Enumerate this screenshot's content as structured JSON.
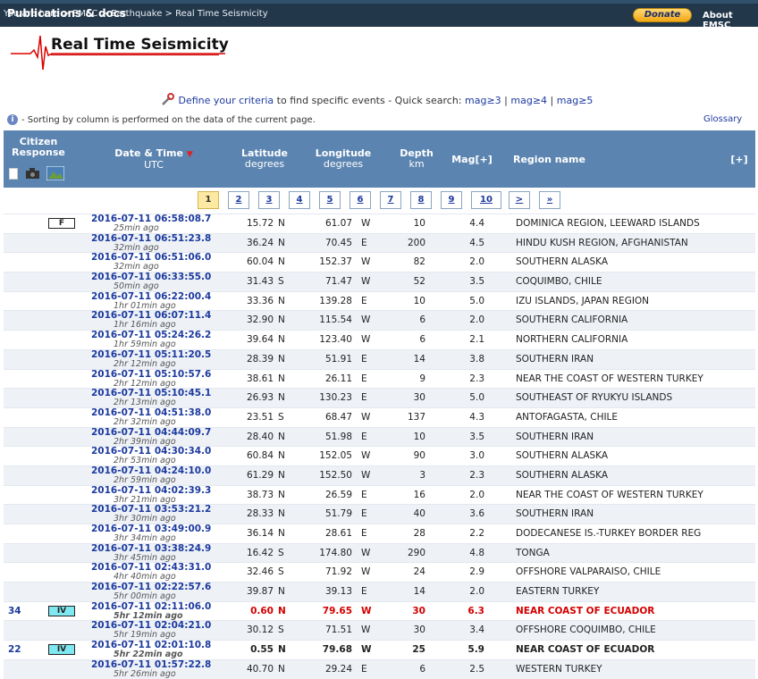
{
  "nav": {
    "breadcrumb": [
      "You are here",
      "EMSC",
      "Earthquake",
      "Real Time Seismicity"
    ],
    "breadcrumb_sep": ">",
    "publications_label": "Publications & docs",
    "donate_label": "Donate",
    "about_label": "About EMSC"
  },
  "page_title": "Real Time Seismicity",
  "criteria": {
    "link_text": "Define your criteria",
    "middle_text": "to find specific events - Quick search:",
    "quick": [
      "mag≥3",
      "mag≥4",
      "mag≥5"
    ]
  },
  "info_text": "- Sorting by column is performed on the data of the current page.",
  "glossary_label": "Glossary",
  "headers": {
    "citizen": "Citizen",
    "response": "Response",
    "datetime": "Date & Time",
    "datetime_sub": "UTC",
    "lat": "Latitude",
    "lat_sub": "degrees",
    "lon": "Longitude",
    "lon_sub": "degrees",
    "depth": "Depth",
    "depth_sub": "km",
    "mag": "Mag[+]",
    "region": "Region name",
    "expand": "[+]"
  },
  "pages": [
    "1",
    "2",
    "3",
    "4",
    "5",
    "6",
    "7",
    "8",
    "9",
    "10",
    ">",
    "»"
  ],
  "active_page": "1",
  "events": [
    {
      "count": "",
      "intensity": "F",
      "dt": "2016-07-11   06:58:08.7",
      "ago": "25min ago",
      "lat": "15.72",
      "ns": "N",
      "lon": "61.07",
      "ew": "W",
      "depth": "10",
      "mag": "4.4",
      "region": "DOMINICA REGION, LEEWARD ISLANDS"
    },
    {
      "count": "",
      "intensity": "",
      "dt": "2016-07-11   06:51:23.8",
      "ago": "32min ago",
      "lat": "36.24",
      "ns": "N",
      "lon": "70.45",
      "ew": "E",
      "depth": "200",
      "mag": "4.5",
      "region": "HINDU KUSH REGION, AFGHANISTAN"
    },
    {
      "count": "",
      "intensity": "",
      "dt": "2016-07-11   06:51:06.0",
      "ago": "32min ago",
      "lat": "60.04",
      "ns": "N",
      "lon": "152.37",
      "ew": "W",
      "depth": "82",
      "mag": "2.0",
      "region": "SOUTHERN ALASKA"
    },
    {
      "count": "",
      "intensity": "",
      "dt": "2016-07-11   06:33:55.0",
      "ago": "50min ago",
      "lat": "31.43",
      "ns": "S",
      "lon": "71.47",
      "ew": "W",
      "depth": "52",
      "mag": "3.5",
      "region": "COQUIMBO, CHILE"
    },
    {
      "count": "",
      "intensity": "",
      "dt": "2016-07-11   06:22:00.4",
      "ago": "1hr 01min ago",
      "lat": "33.36",
      "ns": "N",
      "lon": "139.28",
      "ew": "E",
      "depth": "10",
      "mag": "5.0",
      "region": "IZU ISLANDS, JAPAN REGION"
    },
    {
      "count": "",
      "intensity": "",
      "dt": "2016-07-11   06:07:11.4",
      "ago": "1hr 16min ago",
      "lat": "32.90",
      "ns": "N",
      "lon": "115.54",
      "ew": "W",
      "depth": "6",
      "mag": "2.0",
      "region": "SOUTHERN CALIFORNIA"
    },
    {
      "count": "",
      "intensity": "",
      "dt": "2016-07-11   05:24:26.2",
      "ago": "1hr 59min ago",
      "lat": "39.64",
      "ns": "N",
      "lon": "123.40",
      "ew": "W",
      "depth": "6",
      "mag": "2.1",
      "region": "NORTHERN CALIFORNIA"
    },
    {
      "count": "",
      "intensity": "",
      "dt": "2016-07-11   05:11:20.5",
      "ago": "2hr 12min ago",
      "lat": "28.39",
      "ns": "N",
      "lon": "51.91",
      "ew": "E",
      "depth": "14",
      "mag": "3.8",
      "region": "SOUTHERN IRAN"
    },
    {
      "count": "",
      "intensity": "",
      "dt": "2016-07-11   05:10:57.6",
      "ago": "2hr 12min ago",
      "lat": "38.61",
      "ns": "N",
      "lon": "26.11",
      "ew": "E",
      "depth": "9",
      "mag": "2.3",
      "region": "NEAR THE COAST OF WESTERN TURKEY"
    },
    {
      "count": "",
      "intensity": "",
      "dt": "2016-07-11   05:10:45.1",
      "ago": "2hr 13min ago",
      "lat": "26.93",
      "ns": "N",
      "lon": "130.23",
      "ew": "E",
      "depth": "30",
      "mag": "5.0",
      "region": "SOUTHEAST OF RYUKYU ISLANDS"
    },
    {
      "count": "",
      "intensity": "",
      "dt": "2016-07-11   04:51:38.0",
      "ago": "2hr 32min ago",
      "lat": "23.51",
      "ns": "S",
      "lon": "68.47",
      "ew": "W",
      "depth": "137",
      "mag": "4.3",
      "region": "ANTOFAGASTA, CHILE"
    },
    {
      "count": "",
      "intensity": "",
      "dt": "2016-07-11   04:44:09.7",
      "ago": "2hr 39min ago",
      "lat": "28.40",
      "ns": "N",
      "lon": "51.98",
      "ew": "E",
      "depth": "10",
      "mag": "3.5",
      "region": "SOUTHERN IRAN"
    },
    {
      "count": "",
      "intensity": "",
      "dt": "2016-07-11   04:30:34.0",
      "ago": "2hr 53min ago",
      "lat": "60.84",
      "ns": "N",
      "lon": "152.05",
      "ew": "W",
      "depth": "90",
      "mag": "3.0",
      "region": "SOUTHERN ALASKA"
    },
    {
      "count": "",
      "intensity": "",
      "dt": "2016-07-11   04:24:10.0",
      "ago": "2hr 59min ago",
      "lat": "61.29",
      "ns": "N",
      "lon": "152.50",
      "ew": "W",
      "depth": "3",
      "mag": "2.3",
      "region": "SOUTHERN ALASKA"
    },
    {
      "count": "",
      "intensity": "",
      "dt": "2016-07-11   04:02:39.3",
      "ago": "3hr 21min ago",
      "lat": "38.73",
      "ns": "N",
      "lon": "26.59",
      "ew": "E",
      "depth": "16",
      "mag": "2.0",
      "region": "NEAR THE COAST OF WESTERN TURKEY"
    },
    {
      "count": "",
      "intensity": "",
      "dt": "2016-07-11   03:53:21.2",
      "ago": "3hr 30min ago",
      "lat": "28.33",
      "ns": "N",
      "lon": "51.79",
      "ew": "E",
      "depth": "40",
      "mag": "3.6",
      "region": "SOUTHERN IRAN"
    },
    {
      "count": "",
      "intensity": "",
      "dt": "2016-07-11   03:49:00.9",
      "ago": "3hr 34min ago",
      "lat": "36.14",
      "ns": "N",
      "lon": "28.61",
      "ew": "E",
      "depth": "28",
      "mag": "2.2",
      "region": "DODECANESE IS.-TURKEY BORDER REG"
    },
    {
      "count": "",
      "intensity": "",
      "dt": "2016-07-11   03:38:24.9",
      "ago": "3hr 45min ago",
      "lat": "16.42",
      "ns": "S",
      "lon": "174.80",
      "ew": "W",
      "depth": "290",
      "mag": "4.8",
      "region": "TONGA"
    },
    {
      "count": "",
      "intensity": "",
      "dt": "2016-07-11   02:43:31.0",
      "ago": "4hr 40min ago",
      "lat": "32.46",
      "ns": "S",
      "lon": "71.92",
      "ew": "W",
      "depth": "24",
      "mag": "2.9",
      "region": "OFFSHORE VALPARAISO, CHILE"
    },
    {
      "count": "",
      "intensity": "",
      "dt": "2016-07-11   02:22:57.6",
      "ago": "5hr 00min ago",
      "lat": "39.87",
      "ns": "N",
      "lon": "39.13",
      "ew": "E",
      "depth": "14",
      "mag": "2.0",
      "region": "EASTERN TURKEY"
    },
    {
      "count": "34",
      "intensity": "IV",
      "dt": "2016-07-11   02:11:06.0",
      "ago": "5hr 12min ago",
      "lat": "0.60",
      "ns": "N",
      "lon": "79.65",
      "ew": "W",
      "depth": "30",
      "mag": "6.3",
      "region": "NEAR COAST OF ECUADOR"
    },
    {
      "count": "",
      "intensity": "",
      "dt": "2016-07-11   02:04:21.0",
      "ago": "5hr 19min ago",
      "lat": "30.12",
      "ns": "S",
      "lon": "71.51",
      "ew": "W",
      "depth": "30",
      "mag": "3.4",
      "region": "OFFSHORE COQUIMBO, CHILE"
    },
    {
      "count": "22",
      "intensity": "IV",
      "dt": "2016-07-11   02:01:10.8",
      "ago": "5hr 22min ago",
      "lat": "0.55",
      "ns": "N",
      "lon": "79.68",
      "ew": "W",
      "depth": "25",
      "mag": "5.9",
      "region": "NEAR COAST OF ECUADOR"
    },
    {
      "count": "",
      "intensity": "",
      "dt": "2016-07-11   01:57:22.8",
      "ago": "5hr 26min ago",
      "lat": "40.70",
      "ns": "N",
      "lon": "29.24",
      "ew": "E",
      "depth": "6",
      "mag": "2.5",
      "region": "WESTERN TURKEY"
    }
  ],
  "colors": {
    "header_bg": "#5b84b0",
    "nav_bg": "#23374b",
    "link": "#1c3a9e",
    "highlight_red": "#d40000",
    "intensity_iv": "#7fe8f0"
  }
}
